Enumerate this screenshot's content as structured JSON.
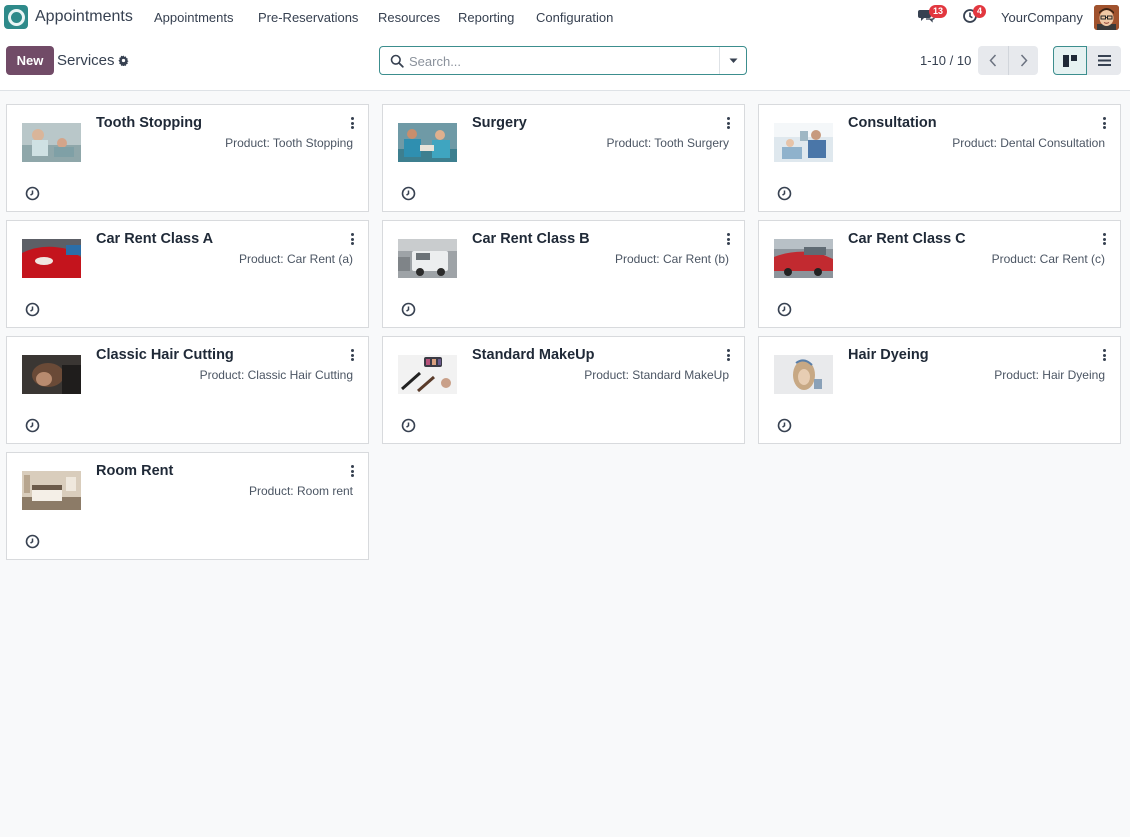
{
  "app": {
    "name": "Appointments"
  },
  "menu": [
    "Appointments",
    "Pre-Reservations",
    "Resources",
    "Reporting",
    "Configuration"
  ],
  "systray": {
    "messages_count": "13",
    "activities_count": "4",
    "company": "YourCompany"
  },
  "control": {
    "new_label": "New",
    "title": "Services",
    "search_placeholder": "Search...",
    "pager": "1-10 / 10"
  },
  "cards": [
    {
      "title": "Tooth Stopping",
      "product": "Product: Tooth Stopping"
    },
    {
      "title": "Surgery",
      "product": "Product: Tooth Surgery"
    },
    {
      "title": "Consultation",
      "product": "Product: Dental Consultation"
    },
    {
      "title": "Car Rent Class A",
      "product": "Product: Car Rent (a)"
    },
    {
      "title": "Car Rent Class B",
      "product": "Product: Car Rent (b)"
    },
    {
      "title": "Car Rent Class C",
      "product": "Product: Car Rent (c)"
    },
    {
      "title": "Classic Hair Cutting",
      "product": "Product: Classic Hair Cutting"
    },
    {
      "title": "Standard MakeUp",
      "product": "Product: Standard MakeUp"
    },
    {
      "title": "Hair Dyeing",
      "product": "Product: Hair Dyeing"
    },
    {
      "title": "Room Rent",
      "product": "Product: Room rent"
    }
  ],
  "colors": {
    "primary": "#714b67",
    "accent": "#2e8a8a",
    "badge": "#e2373f"
  }
}
